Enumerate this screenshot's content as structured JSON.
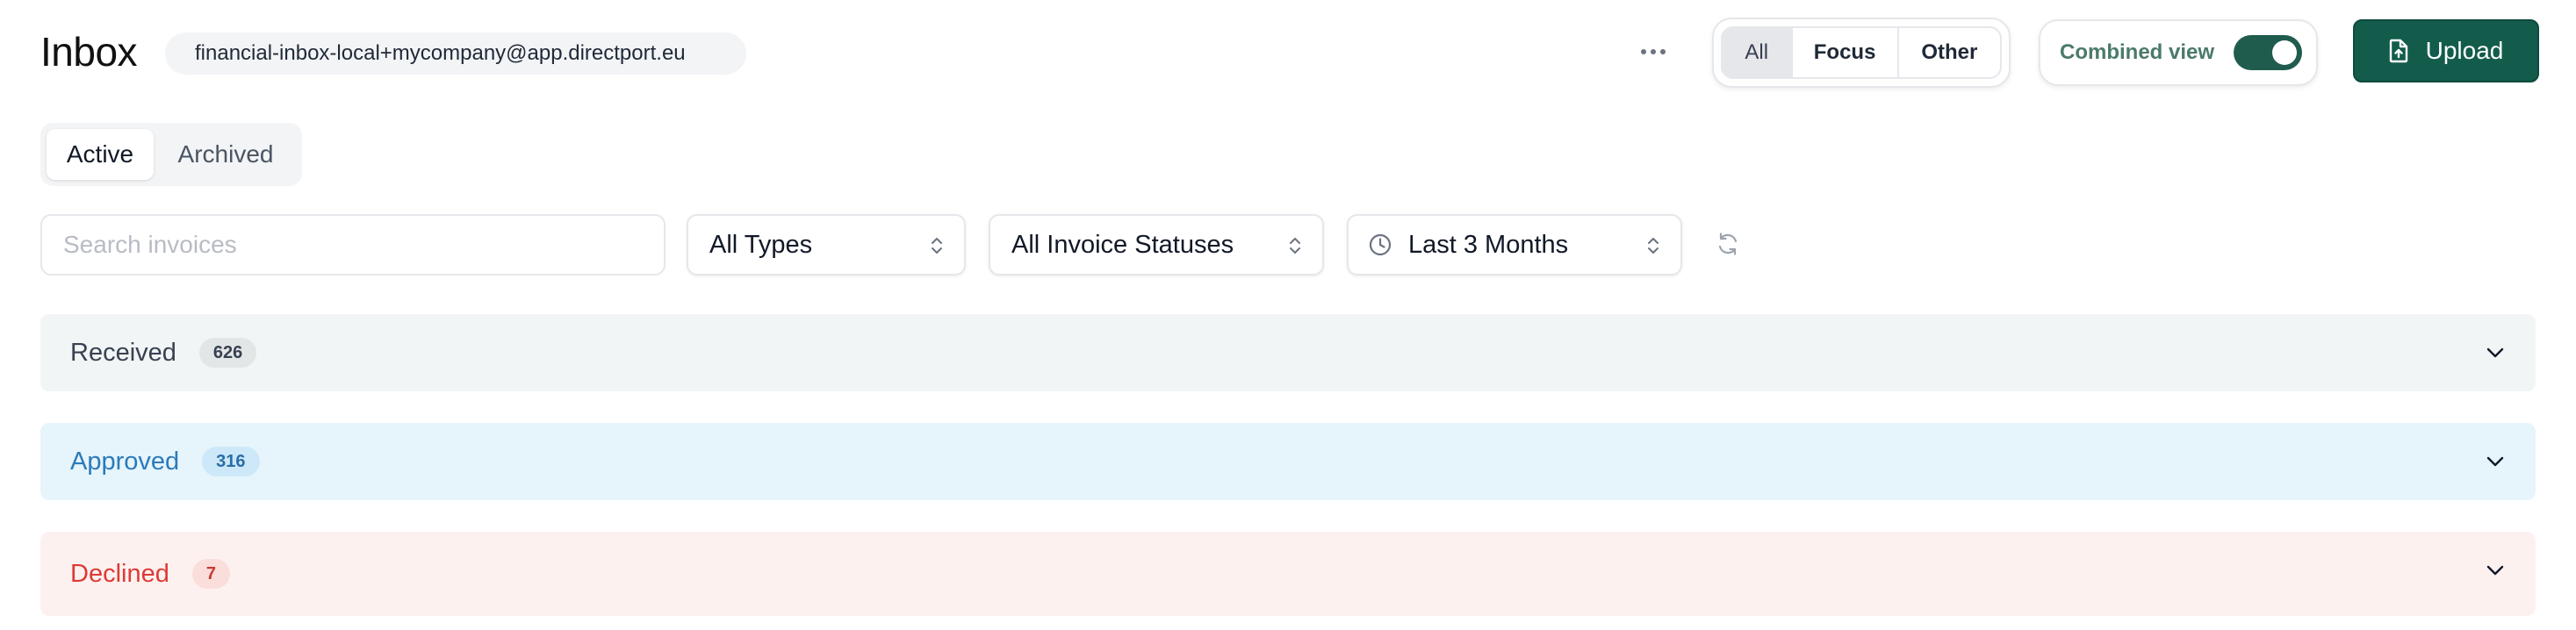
{
  "header": {
    "title": "Inbox",
    "email": "financial-inbox-local+mycompany@app.directport.eu",
    "more_icon": "more-horizontal-icon",
    "segments": [
      {
        "label": "All",
        "active": true
      },
      {
        "label": "Focus",
        "active": false
      },
      {
        "label": "Other",
        "active": false
      }
    ],
    "combined_view_label": "Combined view",
    "combined_view_on": true,
    "upload_label": "Upload",
    "upload_icon": "file-upload-icon",
    "accent_color": "#135c4c"
  },
  "tabs": [
    {
      "label": "Active",
      "active": true
    },
    {
      "label": "Archived",
      "active": false
    }
  ],
  "filters": {
    "search_placeholder": "Search invoices",
    "search_value": "",
    "type": "All Types",
    "status": "All Invoice Statuses",
    "range": "Last 3 Months",
    "range_icon": "clock-icon",
    "refresh_icon": "refresh-icon"
  },
  "sections": [
    {
      "label": "Received",
      "count": "626",
      "color": "#374151"
    },
    {
      "label": "Approved",
      "count": "316",
      "color": "#2b7bb9"
    },
    {
      "label": "Declined",
      "count": "7",
      "color": "#dc3b34"
    }
  ]
}
